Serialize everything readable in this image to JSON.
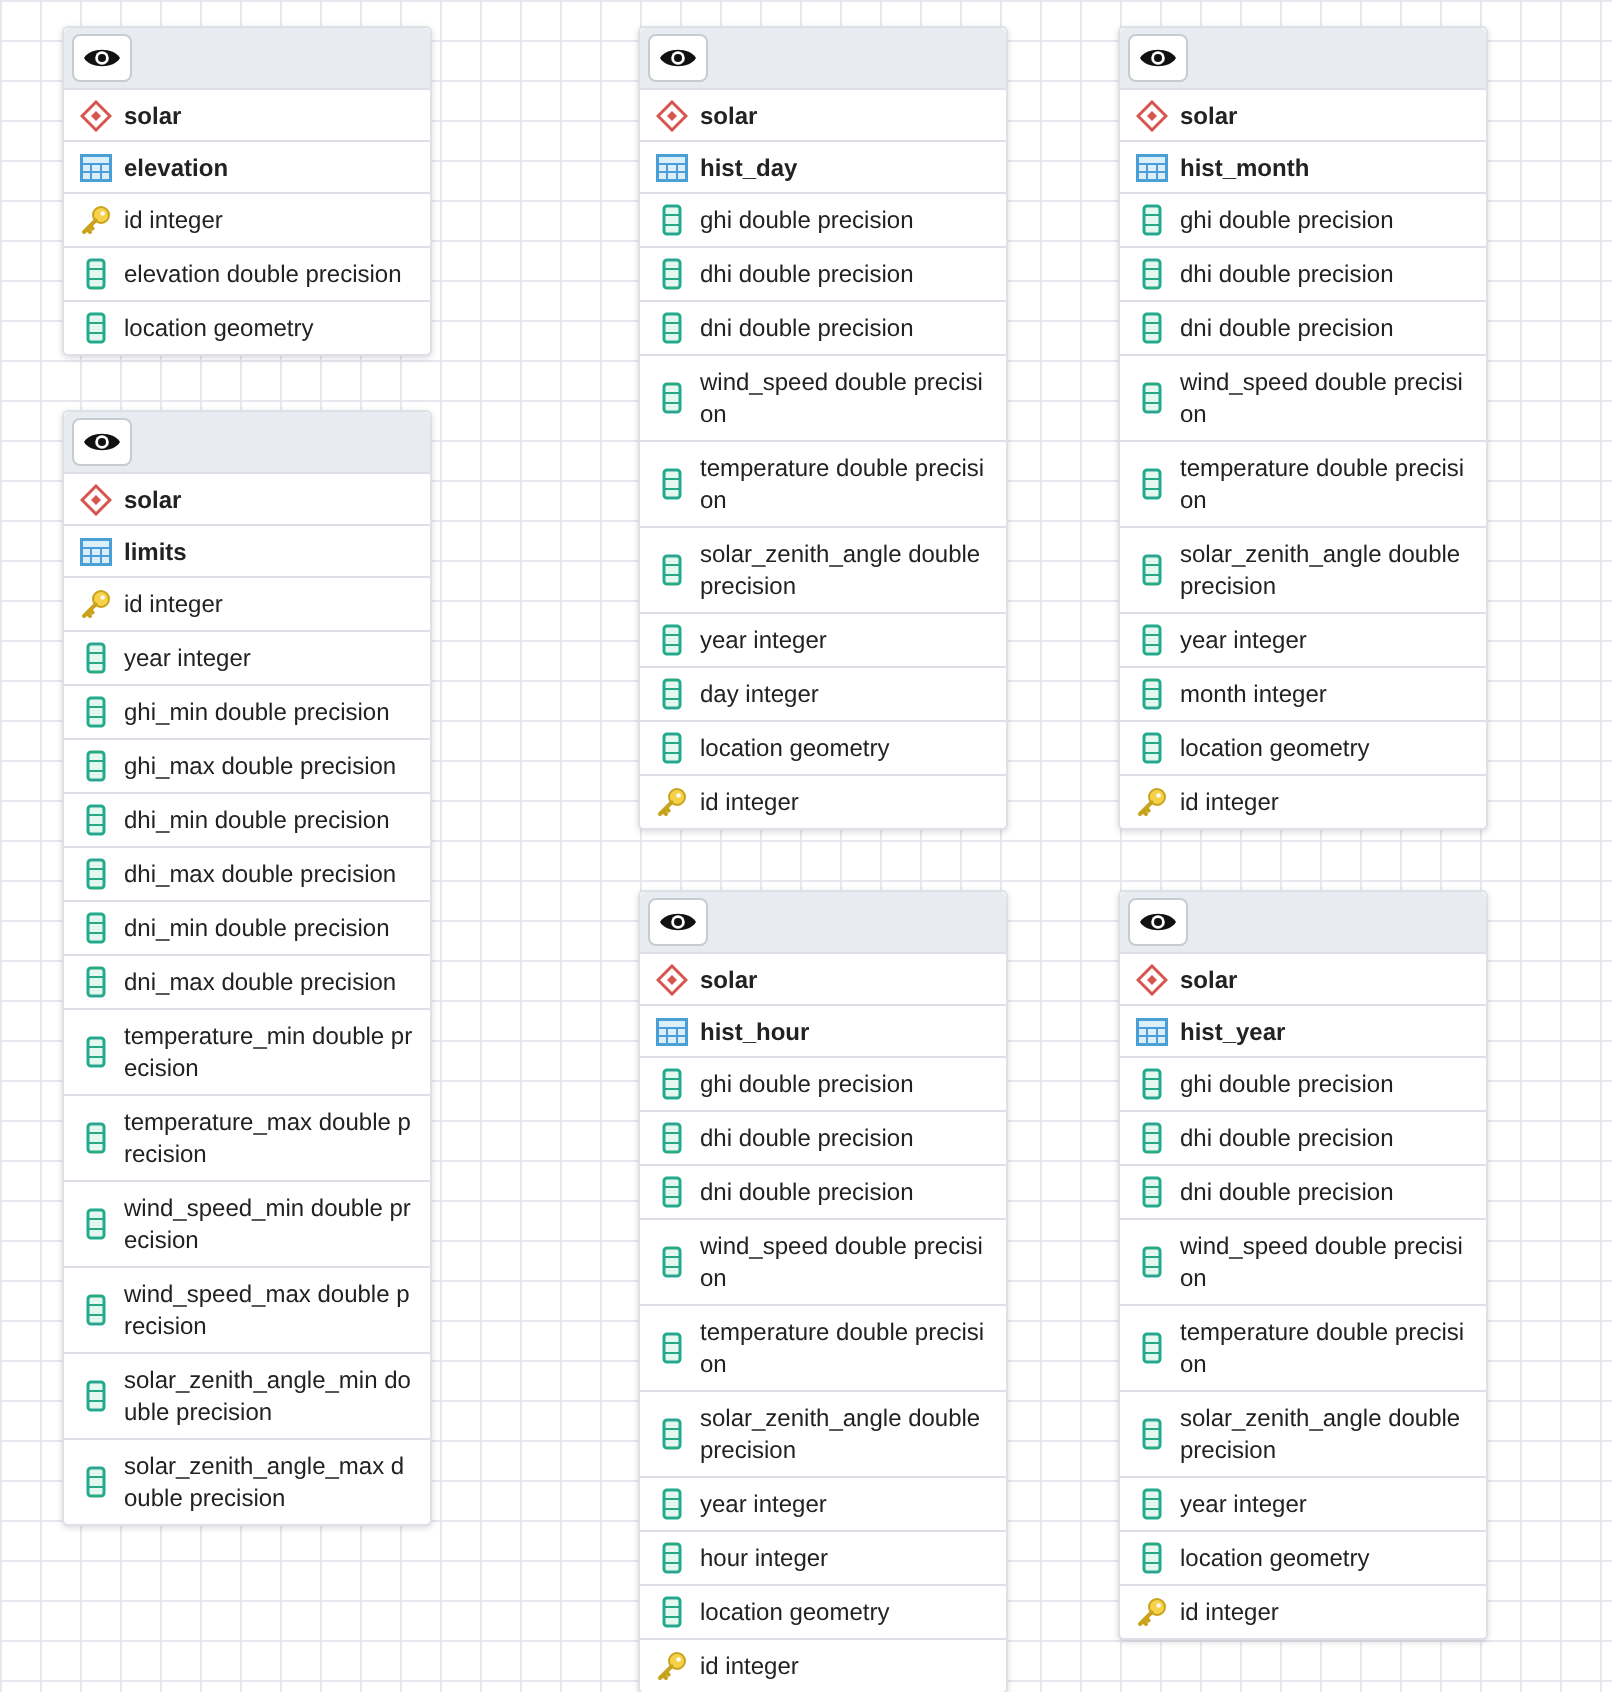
{
  "tables": [
    {
      "schema": "solar",
      "name": "elevation",
      "columns": [
        {
          "kind": "key",
          "text": "id integer"
        },
        {
          "kind": "column",
          "text": "elevation double precision"
        },
        {
          "kind": "column",
          "text": "location geometry"
        }
      ]
    },
    {
      "schema": "solar",
      "name": "limits",
      "columns": [
        {
          "kind": "key",
          "text": "id integer"
        },
        {
          "kind": "column",
          "text": "year integer"
        },
        {
          "kind": "column",
          "text": "ghi_min double precision"
        },
        {
          "kind": "column",
          "text": "ghi_max double precision"
        },
        {
          "kind": "column",
          "text": "dhi_min double precision"
        },
        {
          "kind": "column",
          "text": "dhi_max double precision"
        },
        {
          "kind": "column",
          "text": "dni_min double precision"
        },
        {
          "kind": "column",
          "text": "dni_max double precision"
        },
        {
          "kind": "column",
          "text": "temperature_min double precision"
        },
        {
          "kind": "column",
          "text": "temperature_max double precision"
        },
        {
          "kind": "column",
          "text": "wind_speed_min double precision"
        },
        {
          "kind": "column",
          "text": "wind_speed_max double precision"
        },
        {
          "kind": "column",
          "text": "solar_zenith_angle_min double precision"
        },
        {
          "kind": "column",
          "text": "solar_zenith_angle_max double precision"
        }
      ]
    },
    {
      "schema": "solar",
      "name": "hist_day",
      "columns": [
        {
          "kind": "column",
          "text": "ghi double precision"
        },
        {
          "kind": "column",
          "text": "dhi double precision"
        },
        {
          "kind": "column",
          "text": "dni double precision"
        },
        {
          "kind": "column",
          "text": "wind_speed double precision"
        },
        {
          "kind": "column",
          "text": "temperature double precision"
        },
        {
          "kind": "column",
          "text": "solar_zenith_angle double precision"
        },
        {
          "kind": "column",
          "text": "year integer"
        },
        {
          "kind": "column",
          "text": "day integer"
        },
        {
          "kind": "column",
          "text": "location geometry"
        },
        {
          "kind": "key",
          "text": "id integer"
        }
      ]
    },
    {
      "schema": "solar",
      "name": "hist_month",
      "columns": [
        {
          "kind": "column",
          "text": "ghi double precision"
        },
        {
          "kind": "column",
          "text": "dhi double precision"
        },
        {
          "kind": "column",
          "text": "dni double precision"
        },
        {
          "kind": "column",
          "text": "wind_speed double precision"
        },
        {
          "kind": "column",
          "text": "temperature double precision"
        },
        {
          "kind": "column",
          "text": "solar_zenith_angle double precision"
        },
        {
          "kind": "column",
          "text": "year integer"
        },
        {
          "kind": "column",
          "text": "month integer"
        },
        {
          "kind": "column",
          "text": "location geometry"
        },
        {
          "kind": "key",
          "text": "id integer"
        }
      ]
    },
    {
      "schema": "solar",
      "name": "hist_hour",
      "columns": [
        {
          "kind": "column",
          "text": "ghi double precision"
        },
        {
          "kind": "column",
          "text": "dhi double precision"
        },
        {
          "kind": "column",
          "text": "dni double precision"
        },
        {
          "kind": "column",
          "text": "wind_speed double precision"
        },
        {
          "kind": "column",
          "text": "temperature double precision"
        },
        {
          "kind": "column",
          "text": "solar_zenith_angle double precision"
        },
        {
          "kind": "column",
          "text": "year integer"
        },
        {
          "kind": "column",
          "text": "hour integer"
        },
        {
          "kind": "column",
          "text": "location geometry"
        },
        {
          "kind": "key",
          "text": "id integer"
        }
      ]
    },
    {
      "schema": "solar",
      "name": "hist_year",
      "columns": [
        {
          "kind": "column",
          "text": "ghi double precision"
        },
        {
          "kind": "column",
          "text": "dhi double precision"
        },
        {
          "kind": "column",
          "text": "dni double precision"
        },
        {
          "kind": "column",
          "text": "wind_speed double precision"
        },
        {
          "kind": "column",
          "text": "temperature double precision"
        },
        {
          "kind": "column",
          "text": "solar_zenith_angle double precision"
        },
        {
          "kind": "column",
          "text": "year integer"
        },
        {
          "kind": "column",
          "text": "location geometry"
        },
        {
          "kind": "key",
          "text": "id integer"
        }
      ]
    }
  ]
}
